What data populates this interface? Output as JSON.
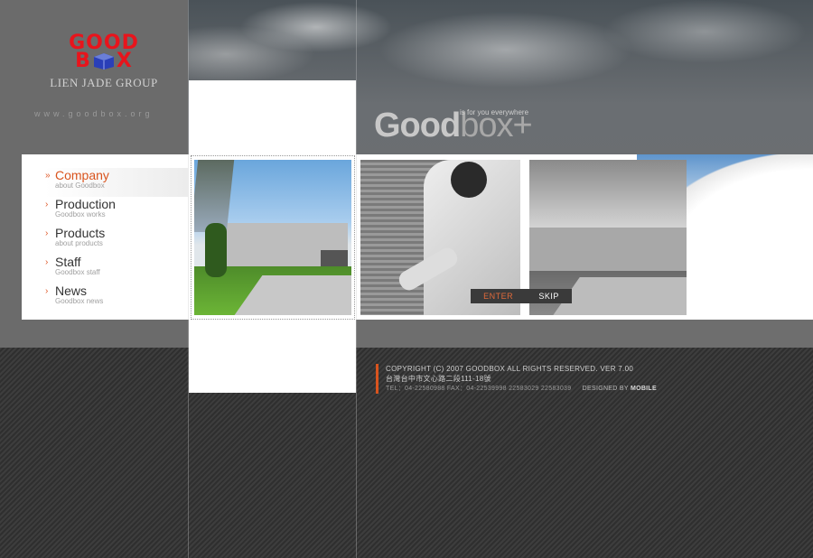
{
  "logo": {
    "line1": "GOOD",
    "line2_left": "B",
    "line2_right": "X",
    "group": "LIEN JADE GROUP"
  },
  "site_url": "www.goodbox.org",
  "brand": {
    "word_a": "Good",
    "word_b": "box+",
    "tagline": "is for you everywhere"
  },
  "menu": [
    {
      "title": "Company",
      "sub": "about Goodbox",
      "active": true
    },
    {
      "title": "Production",
      "sub": "Goodbox works",
      "active": false
    },
    {
      "title": "Products",
      "sub": "about products",
      "active": false
    },
    {
      "title": "Staff",
      "sub": "Goodbox staff",
      "active": false
    },
    {
      "title": "News",
      "sub": "Goodbox news",
      "active": false
    }
  ],
  "buttons": {
    "enter": "ENTER",
    "skip": "SKIP"
  },
  "footer": {
    "copyright": "COPYRIGHT (C) 2007 GOODBOX ALL RIGHTS RESERVED. VER 7.00",
    "address": "台灣台中市文心路二段111-18號",
    "contact": "TEL：04-22580988    FAX：04-22539998    22583029    22583039",
    "designed_by": "DESIGNED BY",
    "designer": "MOBILE"
  },
  "colors": {
    "accent": "#d9541e",
    "logo_red": "#e8141c",
    "logo_blue": "#2a3fb8"
  }
}
